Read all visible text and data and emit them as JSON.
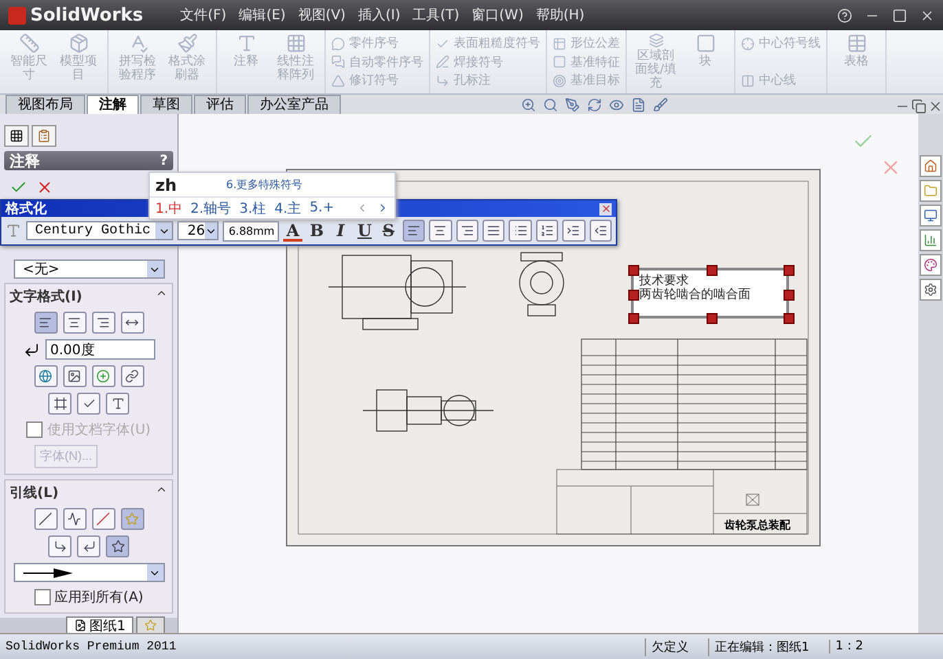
{
  "title_bar": {
    "logo": "SolidWorks",
    "menu": [
      "文件(F)",
      "编辑(E)",
      "视图(V)",
      "插入(I)",
      "工具(T)",
      "窗口(W)",
      "帮助(H)"
    ]
  },
  "ribbon": {
    "disabled": true,
    "groups": [
      {
        "kind": "large",
        "tools": [
          "智能尺寸",
          "模型项目"
        ]
      },
      {
        "kind": "large",
        "tools": [
          "拼写检验程序",
          "格式涂刷器"
        ]
      },
      {
        "kind": "large",
        "tools": [
          "注释",
          "线性注释阵列"
        ]
      },
      {
        "kind": "small",
        "tools": [
          "零件序号",
          "自动零件序号",
          "修订符号"
        ]
      },
      {
        "kind": "small",
        "tools": [
          "表面粗糙度符号",
          "焊接符号",
          "孔标注"
        ]
      },
      {
        "kind": "small",
        "tools": [
          "形位公差",
          "基准特征",
          "基准目标"
        ]
      },
      {
        "kind": "large",
        "tools": [
          "区域剖面线/填充",
          "块"
        ]
      },
      {
        "kind": "small",
        "tools": [
          "中心符号线",
          "中心线"
        ]
      },
      {
        "kind": "large",
        "tools": [
          "表格"
        ]
      }
    ]
  },
  "tabs": [
    {
      "label": "视图布局",
      "selected": false
    },
    {
      "label": "注解",
      "selected": true
    },
    {
      "label": "草图",
      "selected": false
    },
    {
      "label": "评估",
      "selected": false
    },
    {
      "label": "办公室产品",
      "selected": false
    }
  ],
  "property_panel": {
    "title": "注释",
    "help": "?",
    "style_dropdown": "<无>",
    "text_format": {
      "title": "文字格式(I)",
      "angle": "0.00度",
      "use_doc_font": {
        "label": "使用文档字体(U)",
        "checked": false,
        "disabled": true
      },
      "font_button": {
        "label": "字体(N)...",
        "disabled": true
      }
    },
    "leader": {
      "title": "引线(L)",
      "apply_all": {
        "label": "应用到所有(A)",
        "checked": false
      }
    }
  },
  "sheet_tabs": [
    {
      "label": "图纸1",
      "selected": true
    }
  ],
  "format_toolbar": {
    "title": "格式化",
    "font": "Century Gothic",
    "size": "26",
    "height": "6.88mm",
    "styles": [
      "A",
      "B",
      "I",
      "U",
      "S"
    ]
  },
  "ime": {
    "input": "zh",
    "more": "6.更多特殊符号",
    "candidates": [
      {
        "label": "1.中",
        "selected": true
      },
      {
        "label": "2.轴号",
        "selected": false
      },
      {
        "label": "3.柱",
        "selected": false
      },
      {
        "label": "4.主",
        "selected": false
      },
      {
        "label": "5.+",
        "selected": false
      }
    ]
  },
  "drawing": {
    "note": [
      "技术要求",
      "两齿轮啮合的啮合面"
    ],
    "title": "齿轮泵总装配"
  },
  "status_bar": {
    "product": "SolidWorks Premium 2011",
    "fields": [
      "欠定义",
      "正在编辑：图纸1",
      "1 : 2"
    ]
  }
}
